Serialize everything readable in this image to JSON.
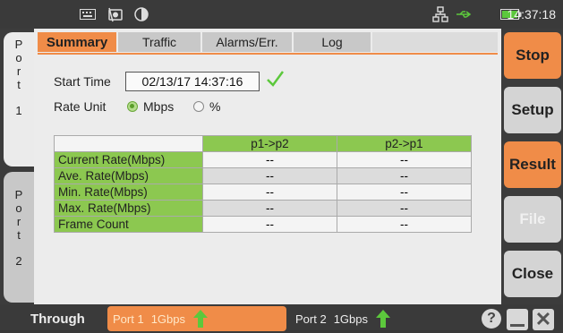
{
  "statusbar": {
    "clock": "14:37:18",
    "icons": [
      "keyboard-icon",
      "screenshot-icon",
      "contrast-icon",
      "network-icon",
      "usb-icon",
      "battery-icon"
    ]
  },
  "ports": {
    "port1_letters": [
      "P",
      "o",
      "r",
      "t",
      "",
      "1"
    ],
    "port2_letters": [
      "P",
      "o",
      "r",
      "t",
      "",
      "2"
    ]
  },
  "tabs": {
    "summary": "Summary",
    "traffic": "Traffic",
    "alarms": "Alarms/Err.",
    "log": "Log"
  },
  "summary": {
    "start_time_label": "Start Time",
    "start_time_value": "02/13/17 14:37:16",
    "rate_unit_label": "Rate Unit",
    "rate_unit_options": [
      "Mbps",
      "%"
    ],
    "rate_unit_selected": "Mbps"
  },
  "table": {
    "columns": [
      "",
      "p1->p2",
      "p2->p1"
    ],
    "rows": [
      {
        "label": "Current Rate(Mbps)",
        "p1p2": "--",
        "p2p1": "--"
      },
      {
        "label": "Ave. Rate(Mbps)",
        "p1p2": "--",
        "p2p1": "--"
      },
      {
        "label": "Min. Rate(Mbps)",
        "p1p2": "--",
        "p2p1": "--"
      },
      {
        "label": "Max. Rate(Mbps)",
        "p1p2": "--",
        "p2p1": "--"
      },
      {
        "label": "Frame Count",
        "p1p2": "--",
        "p2p1": "--"
      }
    ]
  },
  "buttons": {
    "stop": "Stop",
    "setup": "Setup",
    "result": "Result",
    "file": "File",
    "close": "Close"
  },
  "bottombar": {
    "mode": "Through",
    "port1_label": "Port 1",
    "port1_speed": "1Gbps",
    "port2_label": "Port 2",
    "port2_speed": "1Gbps",
    "help": "?"
  },
  "colors": {
    "accent_orange": "#f08c48",
    "table_green": "#8cc850",
    "arrow_green": "#5cc83c"
  }
}
